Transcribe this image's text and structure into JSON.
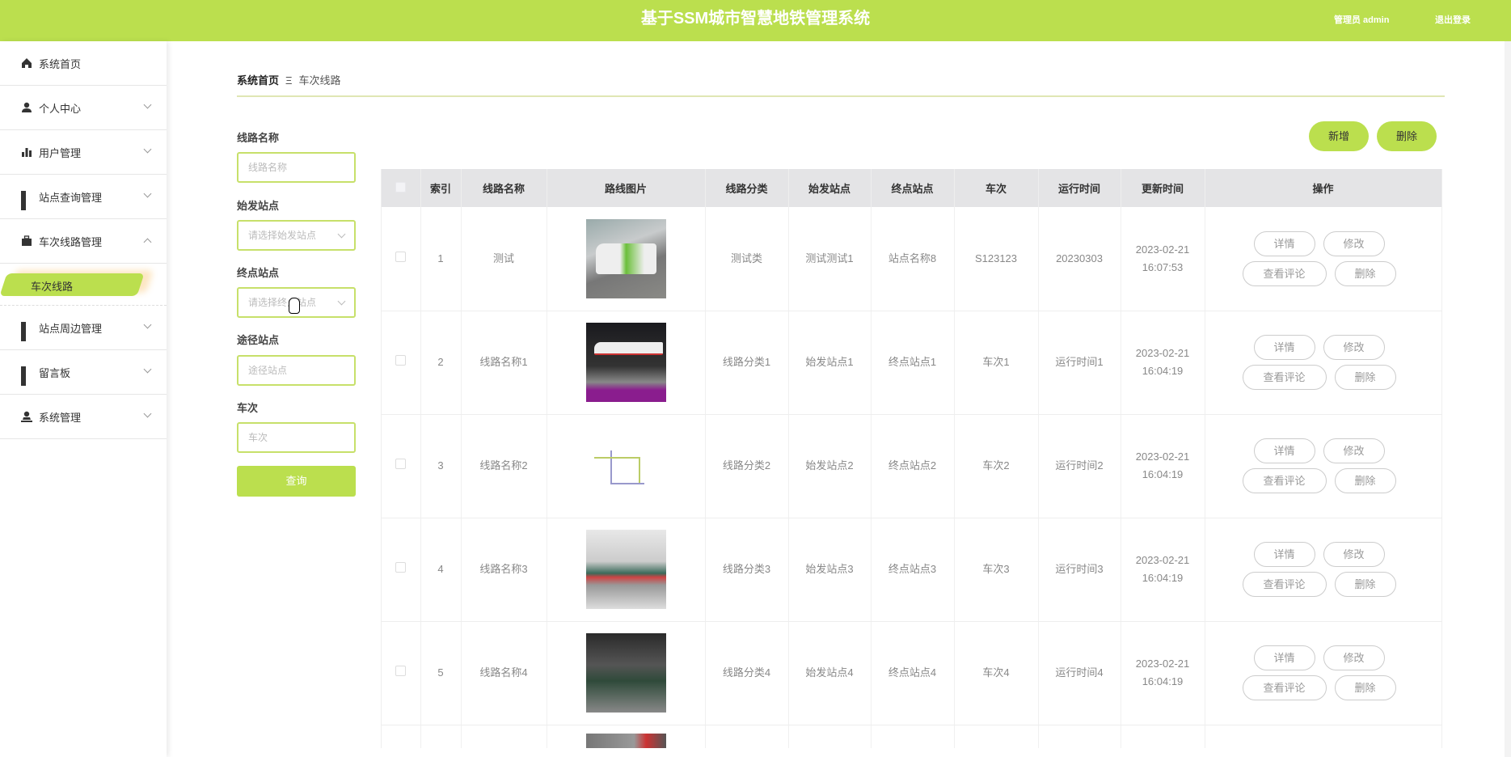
{
  "header": {
    "title": "基于SSM城市智慧地铁管理系统",
    "user": "管理员 admin",
    "logout": "退出登录"
  },
  "sidebar": {
    "items": [
      {
        "label": "系统首页",
        "icon": "home-icon"
      },
      {
        "label": "个人中心",
        "icon": "user-icon"
      },
      {
        "label": "用户管理",
        "icon": "bar-chart-icon"
      },
      {
        "label": "站点查询管理",
        "icon": "grid-icon"
      },
      {
        "label": "车次线路管理",
        "icon": "briefcase-icon"
      },
      {
        "label": "站点周边管理",
        "icon": "grid-icon"
      },
      {
        "label": "留言板",
        "icon": "grid-icon"
      },
      {
        "label": "系统管理",
        "icon": "admin-icon"
      }
    ],
    "active_sub": "车次线路"
  },
  "breadcrumb": {
    "home": "系统首页",
    "sep": "Ξ",
    "current": "车次线路"
  },
  "filters": {
    "route_name": {
      "label": "线路名称",
      "placeholder": "线路名称"
    },
    "start": {
      "label": "始发站点",
      "placeholder": "请选择始发站点"
    },
    "end": {
      "label": "终点站点",
      "placeholder": "请选择终点站点"
    },
    "via": {
      "label": "途径站点",
      "placeholder": "途径站点"
    },
    "train": {
      "label": "车次",
      "placeholder": "车次"
    },
    "query": "查询"
  },
  "toolbar": {
    "add": "新增",
    "delete": "删除"
  },
  "table": {
    "columns": [
      "索引",
      "线路名称",
      "路线图片",
      "线路分类",
      "始发站点",
      "终点站点",
      "车次",
      "运行时间",
      "更新时间",
      "操作"
    ],
    "actions": {
      "detail": "详情",
      "edit": "修改",
      "comments": "查看评论",
      "delete": "删除"
    },
    "rows": [
      {
        "index": "1",
        "name": "测试",
        "category": "测试类",
        "start": "测试测试1",
        "end": "站点名称8",
        "train": "S123123",
        "run_time": "20230303",
        "updated_date": "2023-02-21",
        "updated_time": "16:07:53"
      },
      {
        "index": "2",
        "name": "线路名称1",
        "category": "线路分类1",
        "start": "始发站点1",
        "end": "终点站点1",
        "train": "车次1",
        "run_time": "运行时间1",
        "updated_date": "2023-02-21",
        "updated_time": "16:04:19"
      },
      {
        "index": "3",
        "name": "线路名称2",
        "category": "线路分类2",
        "start": "始发站点2",
        "end": "终点站点2",
        "train": "车次2",
        "run_time": "运行时间2",
        "updated_date": "2023-02-21",
        "updated_time": "16:04:19"
      },
      {
        "index": "4",
        "name": "线路名称3",
        "category": "线路分类3",
        "start": "始发站点3",
        "end": "终点站点3",
        "train": "车次3",
        "run_time": "运行时间3",
        "updated_date": "2023-02-21",
        "updated_time": "16:04:19"
      },
      {
        "index": "5",
        "name": "线路名称4",
        "category": "线路分类4",
        "start": "始发站点4",
        "end": "终点站点4",
        "train": "车次4",
        "run_time": "运行时间4",
        "updated_date": "2023-02-21",
        "updated_time": "16:04:19"
      }
    ]
  }
}
